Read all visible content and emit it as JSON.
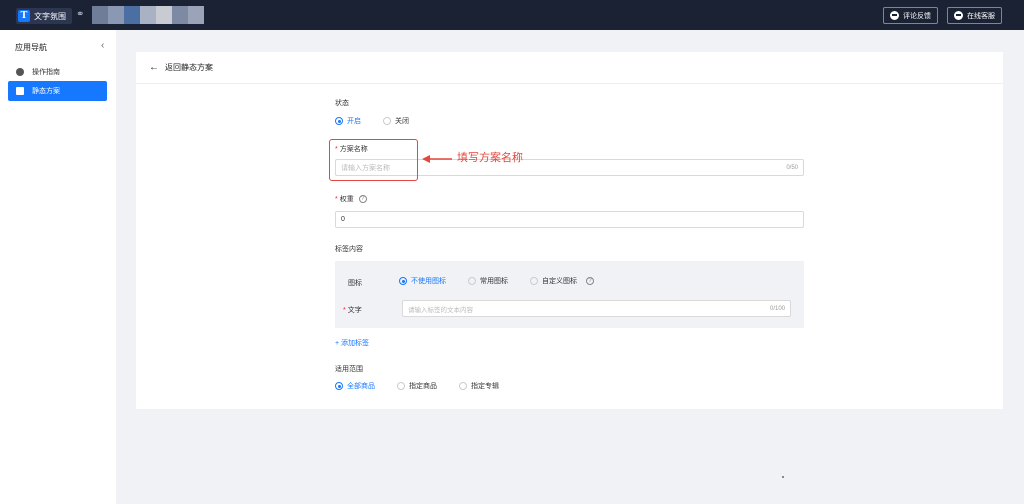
{
  "app": {
    "logo_letter": "T",
    "title": "文字氛围"
  },
  "top_actions": {
    "feedback": "评论反馈",
    "service": "在线客服"
  },
  "sidebar": {
    "title": "应用导航",
    "items": [
      {
        "label": "操作指南"
      },
      {
        "label": "静态方案"
      }
    ]
  },
  "page": {
    "back_label": "返回静态方案"
  },
  "form": {
    "status": {
      "label": "状态",
      "options": [
        "开启",
        "关闭"
      ],
      "selected": "开启"
    },
    "name": {
      "label": "方案名称",
      "placeholder": "请输入方案名称",
      "count": "0/50"
    },
    "weight": {
      "label": "权重",
      "value": "0"
    },
    "tag_content": {
      "label": "标签内容",
      "icon_label": "图标",
      "icon_options": [
        "不使用图标",
        "常用图标",
        "自定义图标"
      ],
      "icon_selected": "不使用图标",
      "text_label": "文字",
      "text_placeholder": "请输入标签的文本内容",
      "text_count": "0/100"
    },
    "add_tag": "添加标签",
    "scope": {
      "label": "适用范围",
      "options": [
        "全部商品",
        "指定商品",
        "指定专辑"
      ],
      "selected": "全部商品"
    }
  },
  "annotation": {
    "text": "填写方案名称",
    "color": "#e2483d"
  },
  "colors": {
    "primary": "#1677ff",
    "topbar": "#1a2233"
  }
}
